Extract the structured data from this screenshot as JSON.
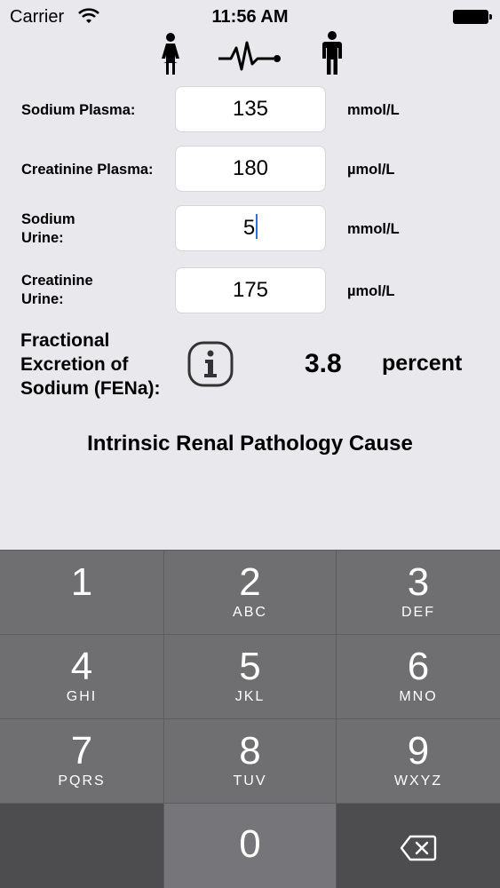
{
  "status_bar": {
    "carrier": "Carrier",
    "time": "11:56 AM"
  },
  "mode_icons": [
    "female-icon",
    "pulse-icon",
    "male-icon"
  ],
  "fields": [
    {
      "label": "Sodium Plasma:",
      "value": "135",
      "unit": "mmol/L"
    },
    {
      "label": "Creatinine Plasma:",
      "value": "180",
      "unit": "µmol/L"
    },
    {
      "label_line1": "Sodium",
      "label_line2": "Urine:",
      "value": "5",
      "unit": "mmol/L"
    },
    {
      "label_line1": "Creatinine",
      "label_line2": "Urine:",
      "value": "175",
      "unit": "µmol/L"
    }
  ],
  "result": {
    "label_line1": "Fractional",
    "label_line2": "Excretion of",
    "label_line3": "Sodium (FENa):",
    "value": "3.8",
    "unit": "percent"
  },
  "diagnosis": "Intrinsic Renal Pathology Cause",
  "keypad": {
    "keys": [
      {
        "digit": "1",
        "letters": ""
      },
      {
        "digit": "2",
        "letters": "ABC"
      },
      {
        "digit": "3",
        "letters": "DEF"
      },
      {
        "digit": "4",
        "letters": "GHI"
      },
      {
        "digit": "5",
        "letters": "JKL"
      },
      {
        "digit": "6",
        "letters": "MNO"
      },
      {
        "digit": "7",
        "letters": "PQRS"
      },
      {
        "digit": "8",
        "letters": "TUV"
      },
      {
        "digit": "9",
        "letters": "WXYZ"
      },
      {
        "digit": "0",
        "letters": ""
      }
    ],
    "delete_icon": "backspace-icon"
  },
  "colors": {
    "background": "#e9e8ed",
    "keypad": "#6f6f72",
    "cursor": "#2f6fde"
  }
}
